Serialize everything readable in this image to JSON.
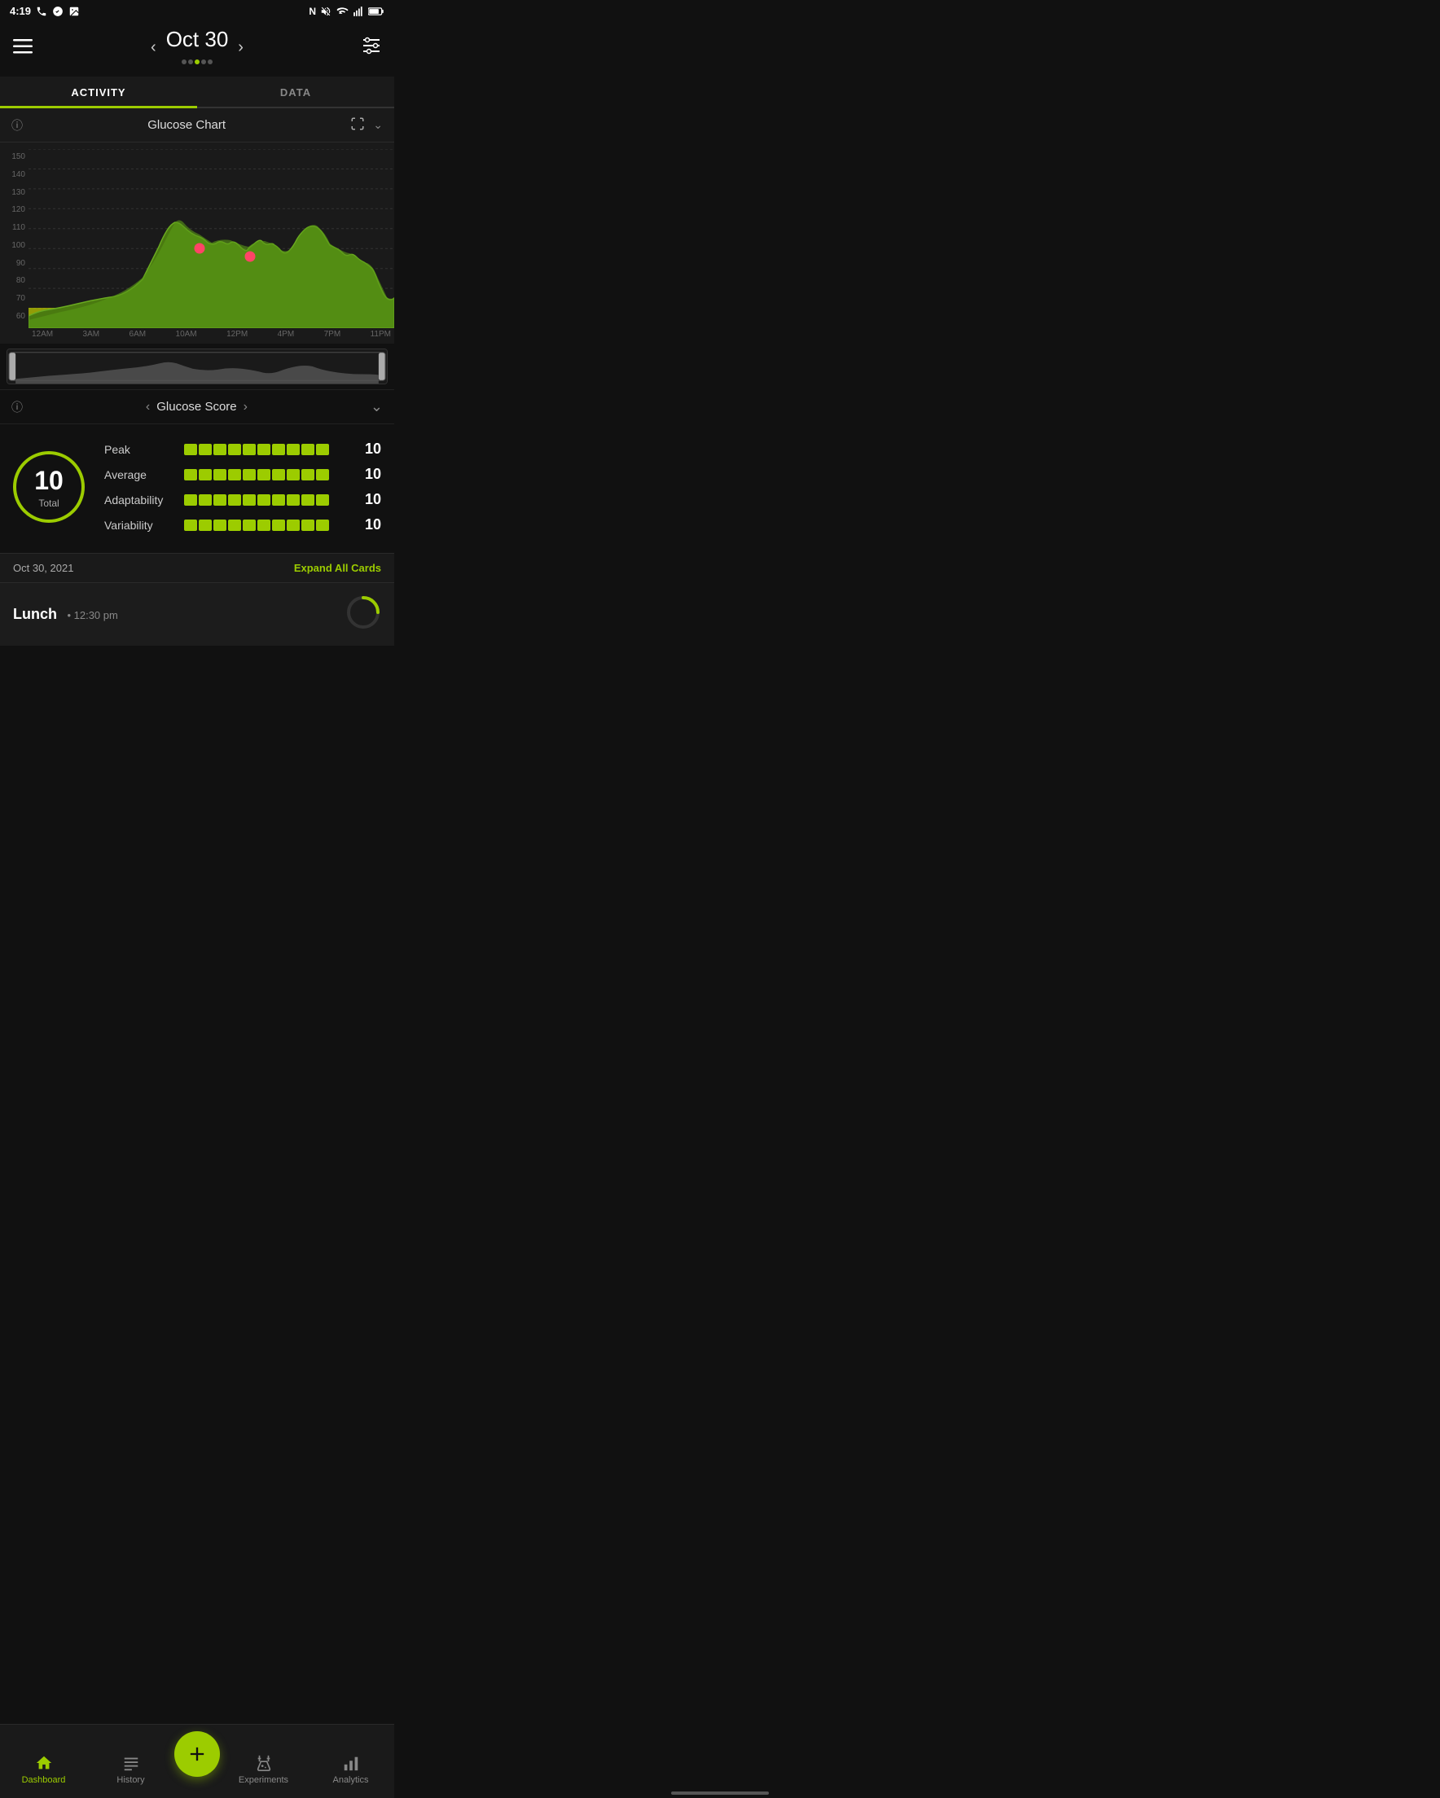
{
  "status": {
    "time": "4:19",
    "icons": [
      "phone",
      "messenger",
      "image"
    ]
  },
  "header": {
    "date": "Oct 30",
    "menu_icon": "☰",
    "settings_icon": "⚙"
  },
  "tabs": [
    {
      "id": "activity",
      "label": "ACTIVITY",
      "active": true
    },
    {
      "id": "data",
      "label": "DATA",
      "active": false
    }
  ],
  "glucose_chart": {
    "title": "Glucose Chart",
    "y_labels": [
      "150",
      "140",
      "130",
      "120",
      "110",
      "100",
      "90",
      "80",
      "70",
      "60"
    ],
    "x_labels": [
      "12AM",
      "3AM",
      "6AM",
      "10AM",
      "12PM",
      "4PM",
      "7PM",
      "11PM"
    ]
  },
  "glucose_score": {
    "title": "Glucose Score",
    "total_value": "10",
    "total_label": "Total",
    "metrics": [
      {
        "label": "Peak",
        "value": "10",
        "filled": 10,
        "partial": 0,
        "empty": 0
      },
      {
        "label": "Average",
        "value": "10",
        "filled": 10,
        "partial": 0,
        "empty": 0
      },
      {
        "label": "Adaptability",
        "value": "10",
        "filled": 10,
        "partial": 0,
        "empty": 0
      },
      {
        "label": "Variability",
        "value": "10",
        "filled": 10,
        "partial": 0,
        "empty": 0
      }
    ]
  },
  "date_footer": {
    "date": "Oct 30, 2021",
    "expand_btn": "Expand All Cards"
  },
  "lunch_preview": {
    "title": "Lunch",
    "time": "• 12:30 pm"
  },
  "bottom_nav": [
    {
      "id": "dashboard",
      "label": "Dashboard",
      "icon": "home",
      "active": true
    },
    {
      "id": "history",
      "label": "History",
      "icon": "list",
      "active": false
    },
    {
      "id": "add",
      "label": "+",
      "fab": true
    },
    {
      "id": "experiments",
      "label": "Experiments",
      "icon": "experiments",
      "active": false
    },
    {
      "id": "analytics",
      "label": "Analytics",
      "icon": "analytics",
      "active": false
    }
  ]
}
